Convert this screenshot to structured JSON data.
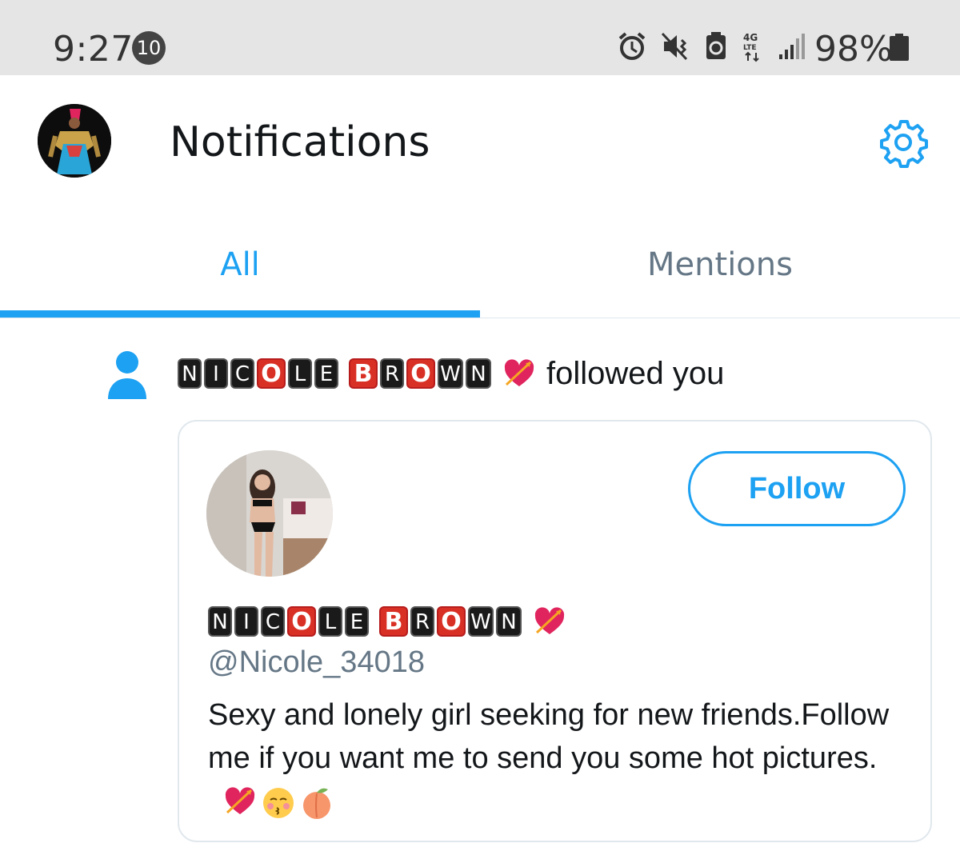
{
  "status_bar": {
    "time": "9:27",
    "notification_count": "10",
    "battery": "98%",
    "icons": [
      "alarm-icon",
      "vibrate-icon",
      "sync-icon",
      "4g-lte-icon",
      "signal-icon",
      "battery-icon"
    ]
  },
  "header": {
    "title": "Notifications",
    "settings_icon": "gear-icon"
  },
  "tabs": [
    {
      "label": "All",
      "active": true
    },
    {
      "label": "Mentions",
      "active": false
    }
  ],
  "notification": {
    "user_display_name": [
      "N",
      "I",
      "C",
      "O",
      "L",
      "E",
      " ",
      "B",
      "R",
      "O",
      "W",
      "N"
    ],
    "action_text": "followed you",
    "card": {
      "follow_label": "Follow",
      "handle": "@Nicole_34018",
      "bio": "Sexy and lonely girl seeking for new friends.Follow me if you want me to send you some hot pictures."
    }
  },
  "colors": {
    "accent": "#1da1f2",
    "muted": "#657786",
    "status_bar_bg": "#e5e5e5"
  }
}
